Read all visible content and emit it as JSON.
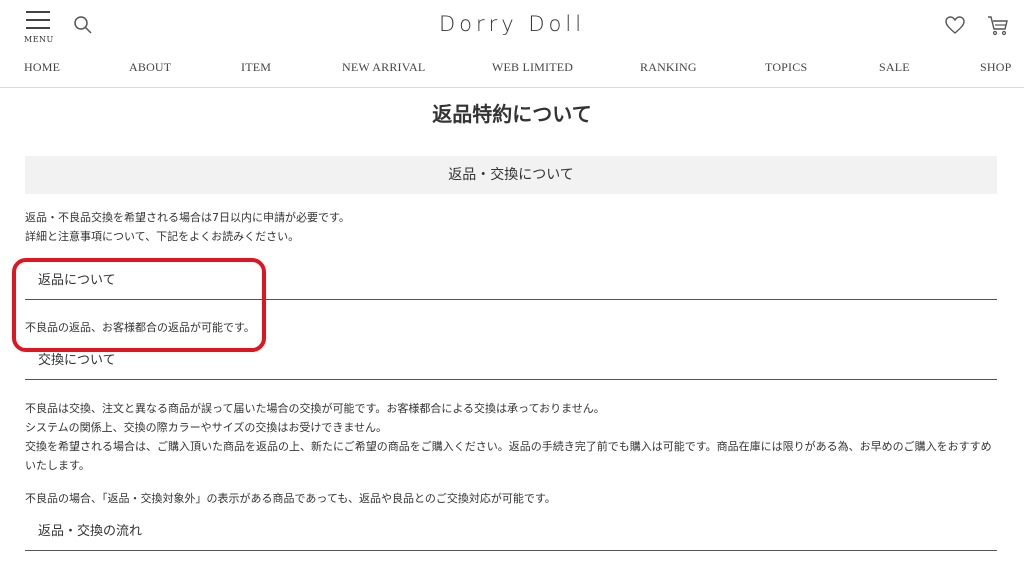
{
  "header": {
    "menu_label": "MENU",
    "brand": "Dorry Doll"
  },
  "nav": [
    {
      "label": "HOME"
    },
    {
      "label": "ABOUT"
    },
    {
      "label": "ITEM"
    },
    {
      "label": "NEW ARRIVAL"
    },
    {
      "label": "WEB LIMITED"
    },
    {
      "label": "RANKING"
    },
    {
      "label": "TOPICS"
    },
    {
      "label": "SALE"
    },
    {
      "label": "SHOP"
    }
  ],
  "main": {
    "title": "返品特約について",
    "section_title": "返品・交換について",
    "intro_line1": "返品・不良品交換を希望される場合は7日以内に申請が必要です。",
    "intro_line2": "詳細と注意事項について、下記をよくお読みください。",
    "returns": {
      "heading": "返品について",
      "text": "不良品の返品、お客様都合の返品が可能です。"
    },
    "exchange": {
      "heading": "交換について",
      "line1": "不良品は交換、注文と異なる商品が誤って届いた場合の交換が可能です。お客様都合による交換は承っておりません。",
      "line2": "システムの関係上、交換の際カラーやサイズの交換はお受けできません。",
      "line3": "交換を希望される場合は、ご購入頂いた商品を返品の上、新たにご希望の商品をご購入ください。返品の手続き完了前でも購入は可能です。商品在庫には限りがある為、お早めのご購入をおすすめいたします。",
      "line4": "不良品の場合、「返品・交換対象外」の表示がある商品であっても、返品や良品とのご交換対応が可能です。"
    },
    "flow": {
      "heading": "返品・交換の流れ"
    }
  },
  "colors": {
    "highlight": "#e0151f",
    "band": "#f2f2f2"
  }
}
